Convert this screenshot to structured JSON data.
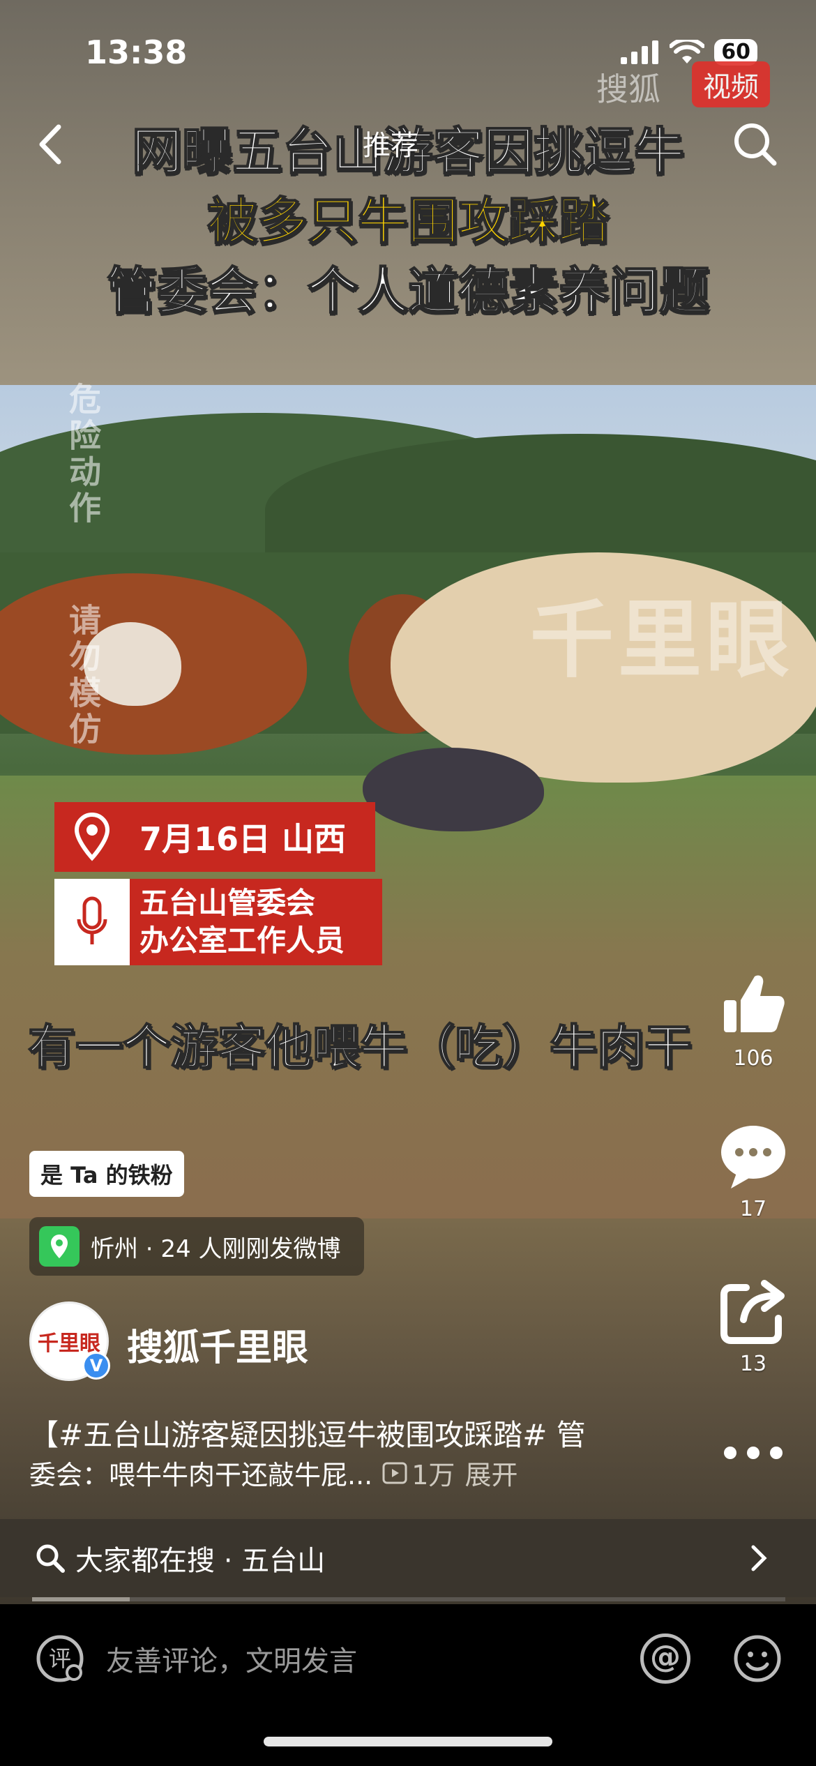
{
  "status_bar": {
    "time": "13:38",
    "battery": "60"
  },
  "top_nav": {
    "tab_label": "推荐"
  },
  "video": {
    "brand_watermark": "搜狐",
    "brand_badge": "视频",
    "headline_line1": "网曝五台山游客因挑逗牛",
    "headline_line2": "被多只牛围攻踩踏",
    "headline_line3": "管委会：个人道德素养问题",
    "warning_text_1": "危险动作",
    "warning_text_2": "请勿模仿",
    "watermark": "千里眼",
    "date_tag": "7月16日 山西",
    "speaker_tag_line1": "五台山管委会",
    "speaker_tag_line2": "办公室工作人员",
    "subtitle": "有一个游客他喂牛（吃）牛肉干"
  },
  "actions": {
    "like_count": "106",
    "comment_count": "17",
    "share_count": "13"
  },
  "post": {
    "fan_badge": "是 Ta 的铁粉",
    "location": "忻州 · 24 人刚刚发微博",
    "avatar_text": "千里眼",
    "author": "搜狐千里眼",
    "caption_line1": "【#五台山游客疑因挑逗牛被围攻踩踏# 管",
    "caption_line2": "委会：喂牛牛肉干还敲牛屁...",
    "play_count": "1万",
    "expand_label": "展开"
  },
  "hot_search": {
    "label": "大家都在搜 · 五台山"
  },
  "comment_bar": {
    "placeholder": "友善评论，文明发言",
    "at_symbol": "@"
  },
  "colors": {
    "accent_red": "#c7281f",
    "headline_yellow": "#ffd400",
    "verified_blue": "#3a8ef0",
    "location_green": "#35c75a"
  },
  "icons": [
    "back-icon",
    "search-icon",
    "location-pin-icon",
    "microphone-icon",
    "thumb-up-icon",
    "comment-icon",
    "share-icon",
    "more-icon",
    "play-icon",
    "chevron-right-icon",
    "comment-edit-icon",
    "at-icon",
    "emoji-icon"
  ],
  "video_progress": 0.13
}
